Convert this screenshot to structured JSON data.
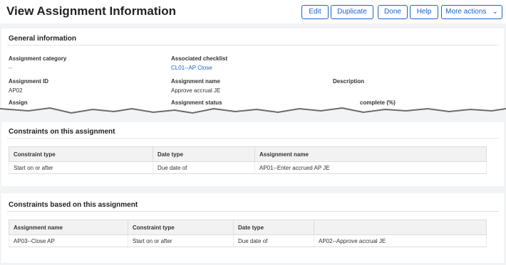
{
  "header": {
    "title": "View Assignment Information",
    "buttons": {
      "edit": "Edit",
      "duplicate": "Duplicate",
      "done": "Done",
      "help": "Help",
      "more": "More actions"
    }
  },
  "general": {
    "title": "General information",
    "assignment_category_label": "Assignment category",
    "assignment_category_value": "--",
    "associated_checklist_label": "Associated checklist",
    "associated_checklist_value": "CL01--AP Close",
    "assignment_id_label": "Assignment ID",
    "assignment_id_value": "AP02",
    "assignment_name_label": "Assignment name",
    "assignment_name_value": "Approve accrual JE",
    "description_label": "Description",
    "partial_label_1": "Assign",
    "partial_label_2": "Assignment status",
    "partial_label_3": "complete (%)"
  },
  "constraints_on": {
    "title": "Constraints on this assignment",
    "columns": [
      "Constraint type",
      "Date type",
      "Assignment name"
    ],
    "rows": [
      [
        "Start on or after",
        "Due date of",
        "AP01--Enter accrued AP JE"
      ]
    ]
  },
  "constraints_based": {
    "title": "Constraints based on this assignment",
    "columns": [
      "Assignment name",
      "Constraint type",
      "Date type",
      ""
    ],
    "rows": [
      [
        "AP03--Close AP",
        "Start on or after",
        "Due date of",
        "AP02--Approve accrual JE"
      ]
    ]
  },
  "colors": {
    "accent": "#1b63c9",
    "background": "#f2f3f5"
  }
}
